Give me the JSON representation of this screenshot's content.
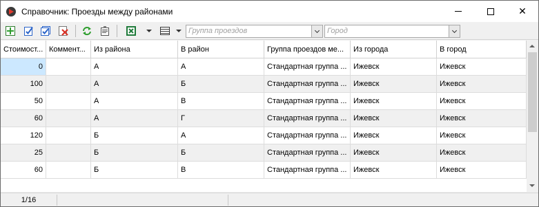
{
  "window": {
    "title": "Справочник: Проезды между районами",
    "minimize_symbol": "",
    "close_symbol": "✕"
  },
  "toolbar": {
    "buttons": [
      {
        "name": "add-icon",
        "color": "#2e9e2e"
      },
      {
        "name": "edit-icon",
        "color": "#2a63c8"
      },
      {
        "name": "edit-multiple-icon",
        "color": "#2a63c8"
      },
      {
        "name": "delete-icon",
        "color": "#d93025"
      },
      {
        "name": "refresh-icon",
        "color": "#2e9e2e"
      },
      {
        "name": "properties-icon",
        "color": "#555555"
      },
      {
        "name": "excel-export-icon",
        "color": "#1f7a3a"
      },
      {
        "name": "columns-icon",
        "color": "#333333"
      }
    ],
    "group_filter": {
      "placeholder": "Группа проездов"
    },
    "city_filter": {
      "placeholder": "Город"
    }
  },
  "table": {
    "columns": [
      "Стоимост...",
      "Коммент...",
      "Из района",
      "В район",
      "Группа проездов ме...",
      "Из города",
      "В город"
    ],
    "rows": [
      {
        "cost": "0",
        "comment": "",
        "from_district": "А",
        "to_district": "А",
        "group": "Стандартная группа ...",
        "from_city": "Ижевск",
        "to_city": "Ижевск"
      },
      {
        "cost": "100",
        "comment": "",
        "from_district": "А",
        "to_district": "Б",
        "group": "Стандартная группа ...",
        "from_city": "Ижевск",
        "to_city": "Ижевск"
      },
      {
        "cost": "50",
        "comment": "",
        "from_district": "А",
        "to_district": "В",
        "group": "Стандартная группа ...",
        "from_city": "Ижевск",
        "to_city": "Ижевск"
      },
      {
        "cost": "60",
        "comment": "",
        "from_district": "А",
        "to_district": "Г",
        "group": "Стандартная группа ...",
        "from_city": "Ижевск",
        "to_city": "Ижевск"
      },
      {
        "cost": "120",
        "comment": "",
        "from_district": "Б",
        "to_district": "А",
        "group": "Стандартная группа ...",
        "from_city": "Ижевск",
        "to_city": "Ижевск"
      },
      {
        "cost": "25",
        "comment": "",
        "from_district": "Б",
        "to_district": "Б",
        "group": "Стандартная группа ...",
        "from_city": "Ижевск",
        "to_city": "Ижевск"
      },
      {
        "cost": "60",
        "comment": "",
        "from_district": "Б",
        "to_district": "В",
        "group": "Стандартная группа ...",
        "from_city": "Ижевск",
        "to_city": "Ижевск"
      }
    ]
  },
  "status": {
    "record_position": "1/16"
  }
}
